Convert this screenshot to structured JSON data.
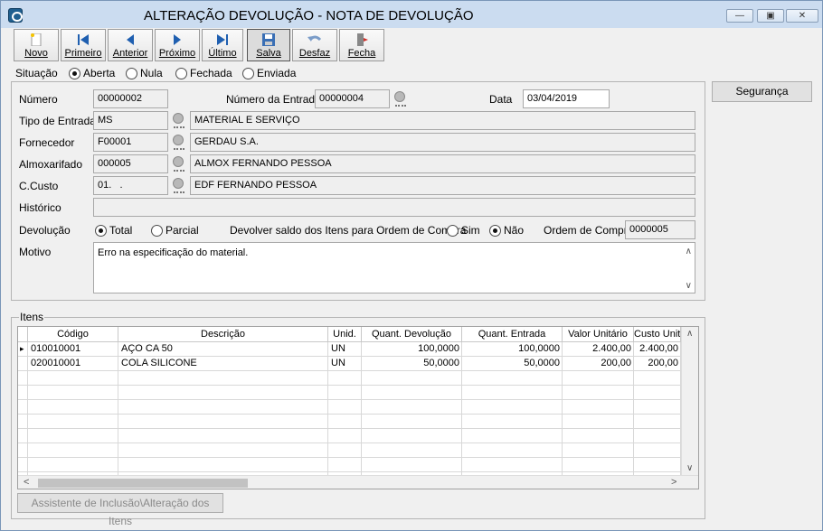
{
  "window": {
    "title": "ALTERAÇÃO DEVOLUÇÃO - NOTA DE DEVOLUÇÃO",
    "min_label": "—",
    "max_label": "▣",
    "close_label": "✕"
  },
  "toolbar": {
    "novo": "Novo",
    "primeiro": "Primeiro",
    "anterior": "Anterior",
    "proximo": "Próximo",
    "ultimo": "Último",
    "salva": "Salva",
    "desfaz": "Desfaz",
    "fecha": "Fecha"
  },
  "situacao": {
    "label": "Situação",
    "aberta": "Aberta",
    "nula": "Nula",
    "fechada": "Fechada",
    "enviada": "Enviada",
    "selected": "Aberta"
  },
  "seguranca": "Segurança",
  "form": {
    "numero_label": "Número",
    "numero": "00000002",
    "numero_entrada_label": "Número da Entrada",
    "numero_entrada": "00000004",
    "data_label": "Data",
    "data": "03/04/2019",
    "tipo_entrada_label": "Tipo de Entrada",
    "tipo_entrada_code": "MS",
    "tipo_entrada_desc": "MATERIAL E SERVIÇO",
    "fornecedor_label": "Fornecedor",
    "fornecedor_code": "F00001",
    "fornecedor_desc": "GERDAU S.A.",
    "almoxarifado_label": "Almoxarifado",
    "almoxarifado_code": "000005",
    "almoxarifado_desc": "ALMOX FERNANDO PESSOA",
    "ccusto_label": "C.Custo",
    "ccusto_code": "01.   .",
    "ccusto_desc": "EDF FERNANDO PESSOA",
    "historico_label": "Histórico",
    "historico": "",
    "devolucao_label": "Devolução",
    "total": "Total",
    "parcial": "Parcial",
    "devolucao_selected": "Total",
    "devolver_label": "Devolver saldo dos Itens para Ordem de Compra",
    "sim": "Sim",
    "nao": "Não",
    "devolver_selected": "Não",
    "ordem_compra_label": "Ordem de Compra",
    "ordem_compra": "0000005",
    "motivo_label": "Motivo",
    "motivo": "Erro na especificação do material."
  },
  "itens": {
    "label": "Itens",
    "columns": [
      "Código",
      "Descrição",
      "Unid.",
      "Quant. Devolução",
      "Quant. Entrada",
      "Valor Unitário",
      "Custo Unitá"
    ],
    "rows": [
      [
        "010010001",
        "AÇO CA 50",
        "UN",
        "100,0000",
        "100,0000",
        "2.400,00",
        "2.400,00"
      ],
      [
        "020010001",
        "COLA SILICONE",
        "UN",
        "50,0000",
        "50,0000",
        "200,00",
        "200,00"
      ]
    ]
  },
  "assistente": "Assistente de Inclusão\\Alteração dos Itens"
}
